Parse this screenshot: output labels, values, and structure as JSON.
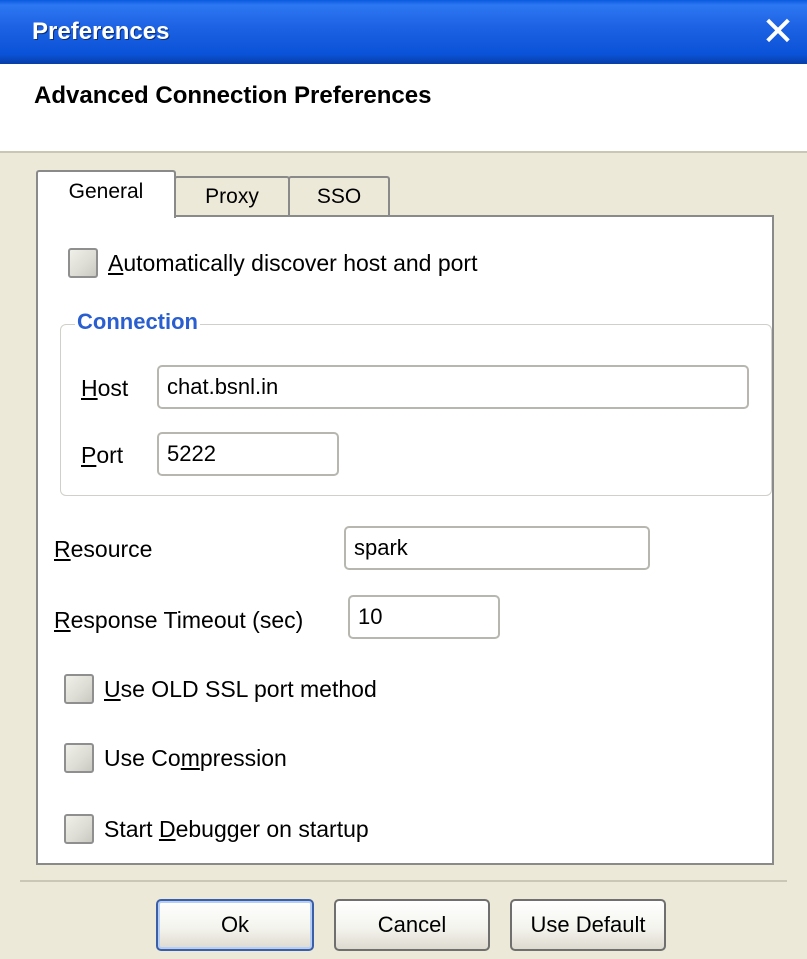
{
  "window": {
    "title": "Preferences"
  },
  "header": {
    "heading": "Advanced Connection Preferences"
  },
  "tabs": [
    {
      "label": "General",
      "active": true
    },
    {
      "label": "Proxy",
      "active": false
    },
    {
      "label": "SSO",
      "active": false
    }
  ],
  "general": {
    "auto_discover": {
      "pre": "",
      "mnemonic": "A",
      "post": "utomatically discover host and port",
      "checked": false
    },
    "connection": {
      "title": "Connection",
      "host_label": {
        "mnemonic": "H",
        "post": "ost"
      },
      "host_value": "chat.bsnl.in",
      "port_label": {
        "mnemonic": "P",
        "post": "ort"
      },
      "port_value": "5222"
    },
    "resource_label": {
      "mnemonic": "R",
      "post": "esource"
    },
    "resource_value": "spark",
    "timeout_label": {
      "mnemonic": "R",
      "post": "esponse Timeout (sec)"
    },
    "timeout_value": "10",
    "old_ssl": {
      "pre": "",
      "mnemonic": "U",
      "post": "se OLD SSL port method",
      "checked": false
    },
    "compression": {
      "pre": "Use Co",
      "mnemonic": "m",
      "post": "pression",
      "checked": false
    },
    "debugger": {
      "pre": "Start ",
      "mnemonic": "D",
      "post": "ebugger on startup",
      "checked": false
    }
  },
  "buttons": {
    "ok": "Ok",
    "cancel": "Cancel",
    "use_default": "Use Default"
  },
  "icons": {
    "close": "close-icon"
  }
}
